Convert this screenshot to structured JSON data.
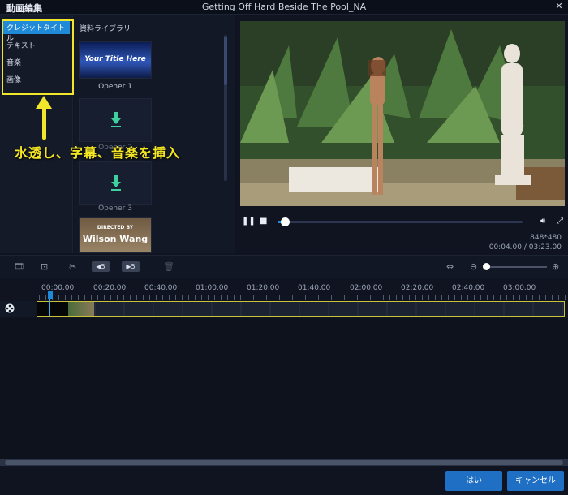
{
  "titlebar": {
    "app_title": "動画編集",
    "window_title": "Getting Off Hard Beside The Pool_NA",
    "minimize": "−",
    "close": "✕"
  },
  "categories": [
    {
      "label": "クレジットタイトル",
      "active": true
    },
    {
      "label": "テキスト",
      "active": false
    },
    {
      "label": "音楽",
      "active": false
    },
    {
      "label": "画像",
      "active": false
    }
  ],
  "annotation": "水透し、字幕、音楽を挿入",
  "library": {
    "header": "資料ライブラリ",
    "items": [
      {
        "type": "title",
        "text": "Your Title Here",
        "label": "Opener 1"
      },
      {
        "type": "download",
        "label": "Opener 2"
      },
      {
        "type": "download",
        "label": "Opener 3"
      },
      {
        "type": "credit",
        "small": "DIRECTED BY",
        "big": "Wilson Wang"
      }
    ]
  },
  "player": {
    "resolution": "848*480",
    "timecode": "00:04.00 / 03:23.00",
    "progress": 0.03
  },
  "timeline": {
    "ticks": [
      "00:00.00",
      "00:20.00",
      "00:40.00",
      "01:00.00",
      "01:20.00",
      "01:40.00",
      "02:00.00",
      "02:20.00",
      "02:40.00",
      "03:00.00"
    ],
    "rewind_label": "◀5",
    "forward_label": "▶5"
  },
  "footer": {
    "ok": "はい",
    "cancel": "キャンセル"
  },
  "colors": {
    "accent": "#1e8ad8",
    "highlight": "#f2e62a",
    "button": "#1f6fc4"
  }
}
